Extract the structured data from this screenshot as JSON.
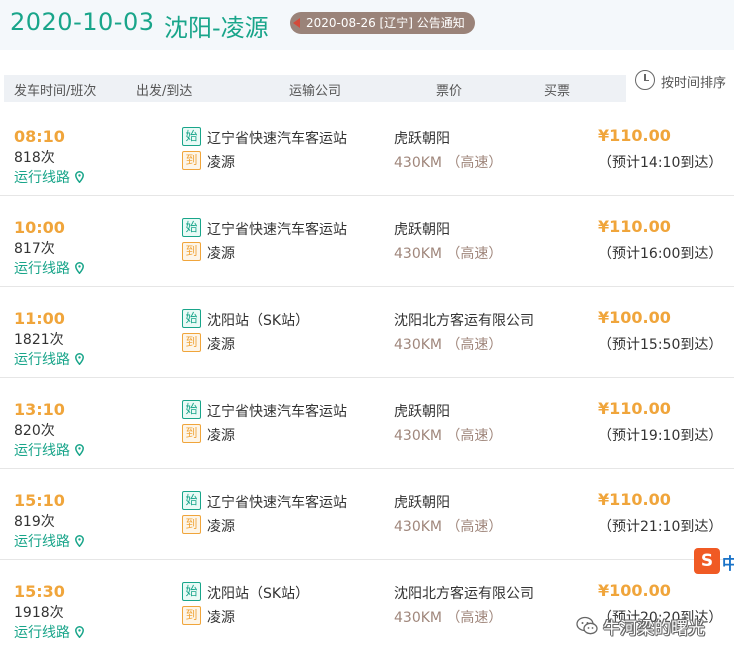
{
  "header": {
    "date": "2020-10-03",
    "route": "沈阳-凌源",
    "notice": "2020-08-26 [辽宁] 公告通知"
  },
  "columns": [
    "发车时间/班次",
    "出发/到达",
    "运输公司",
    "票价",
    "买票"
  ],
  "sort_label": "按时间排序",
  "tags": {
    "start": "始",
    "end": "到"
  },
  "route_link_label": "运行线路",
  "schedules": [
    {
      "time": "08:10",
      "number": "818次",
      "from": "辽宁省快速汽车客运站",
      "to": "凌源",
      "company": "虎跃朝阳",
      "distance": "430KM （高速）",
      "price": "¥110.00",
      "eta": "（预计14:10到达）"
    },
    {
      "time": "10:00",
      "number": "817次",
      "from": "辽宁省快速汽车客运站",
      "to": "凌源",
      "company": "虎跃朝阳",
      "distance": "430KM （高速）",
      "price": "¥110.00",
      "eta": "（预计16:00到达）"
    },
    {
      "time": "11:00",
      "number": "1821次",
      "from": "沈阳站（SK站）",
      "to": "凌源",
      "company": "沈阳北方客运有限公司",
      "distance": "430KM （高速）",
      "price": "¥100.00",
      "eta": "（预计15:50到达）"
    },
    {
      "time": "13:10",
      "number": "820次",
      "from": "辽宁省快速汽车客运站",
      "to": "凌源",
      "company": "虎跃朝阳",
      "distance": "430KM （高速）",
      "price": "¥110.00",
      "eta": "（预计19:10到达）"
    },
    {
      "time": "15:10",
      "number": "819次",
      "from": "辽宁省快速汽车客运站",
      "to": "凌源",
      "company": "虎跃朝阳",
      "distance": "430KM （高速）",
      "price": "¥110.00",
      "eta": "（预计21:10到达）"
    },
    {
      "time": "15:30",
      "number": "1918次",
      "from": "沈阳站（SK站）",
      "to": "凌源",
      "company": "沈阳北方客运有限公司",
      "distance": "430KM （高速）",
      "price": "¥100.00",
      "eta": "（预计20:20到达）"
    }
  ],
  "overlay": {
    "sogou_glyph": "S",
    "sogou_tail": "中",
    "watermark": "牛河梁的曙光"
  },
  "colors": {
    "accent_green": "#19a58a",
    "price_orange": "#f0a53b",
    "distance_brown": "#a0877c",
    "notice_bg": "#9a8379"
  }
}
